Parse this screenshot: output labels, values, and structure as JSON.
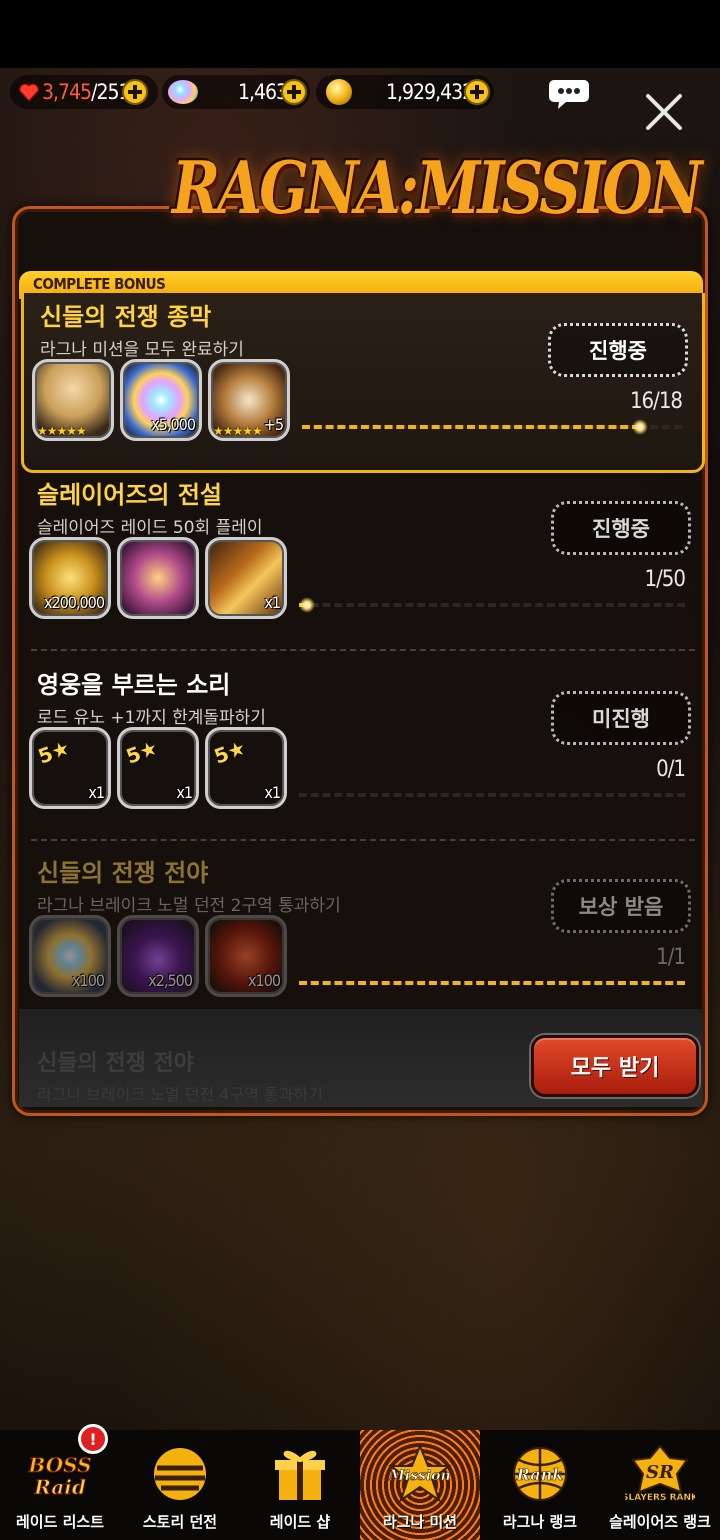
{
  "topbar": {
    "hearts": "3,745",
    "hearts_max": "/251",
    "gems": "1,463",
    "gold": "1,929,432"
  },
  "title": "RAGNA:MISSION",
  "bonus_label": "COMPLETE BONUS",
  "missions": [
    {
      "title": "신들의 전쟁 종막",
      "desc": "라그나 미션을 모두 완료하기",
      "status": "진행중",
      "count": "16/18",
      "progress": 0.89,
      "rewards": [
        {
          "icon": "hero-card",
          "qty": "",
          "stars": "★★★★★"
        },
        {
          "icon": "rainbow-gem",
          "qty": "x5,000",
          "stars": ""
        },
        {
          "icon": "limit-break-plus5",
          "qty": "+5",
          "stars": "★★★★★"
        }
      ]
    },
    {
      "title": "슬레이어즈의 전설",
      "desc": "슬레이어즈 레이드 50회 플레이",
      "status": "진행중",
      "count": "1/50",
      "progress": 0.02,
      "rewards": [
        {
          "icon": "gold-coins",
          "qty": "x200,000"
        },
        {
          "icon": "treasure-box",
          "qty": ""
        },
        {
          "icon": "ticket",
          "qty": "x1"
        }
      ]
    },
    {
      "title": "영웅을 부르는 소리",
      "desc": "로드 유노 +1까지 한계돌파하기",
      "status": "미진행",
      "count": "0/1",
      "progress": 0,
      "rewards": [
        {
          "icon": "limit-ticket",
          "qty": "x1"
        },
        {
          "icon": "limit-ticket",
          "qty": "x1"
        },
        {
          "icon": "limit-ticket",
          "qty": "x1"
        }
      ]
    },
    {
      "title": "신들의 전쟁 전야",
      "desc": "라그나 브레이크 노멀 던전 2구역 통과하기",
      "status": "보상 받음",
      "count": "1/1",
      "progress": 1,
      "rewards": [
        {
          "icon": "opal-gem",
          "qty": "x100"
        },
        {
          "icon": "purple-crystal",
          "qty": "x2,500"
        },
        {
          "icon": "heart-item",
          "qty": "x100"
        }
      ]
    }
  ],
  "ghost_mission": {
    "title": "신들의 전쟁 전야",
    "desc": "라그나 브레이크 노멀 던전 4구역 통과하기"
  },
  "claim_all_label": "모두 받기",
  "nav": [
    {
      "label": "레이드 리스트",
      "badge": "!"
    },
    {
      "label": "스토리 던전"
    },
    {
      "label": "레이드 샵"
    },
    {
      "label": "라그나 미션",
      "active": true
    },
    {
      "label": "라그나 랭크"
    },
    {
      "label": "슬레이어즈 랭크"
    }
  ],
  "colors": {
    "accent_gold": "#f2b516",
    "panel_border": "#c3571b",
    "claim_button": "#c92f17"
  }
}
